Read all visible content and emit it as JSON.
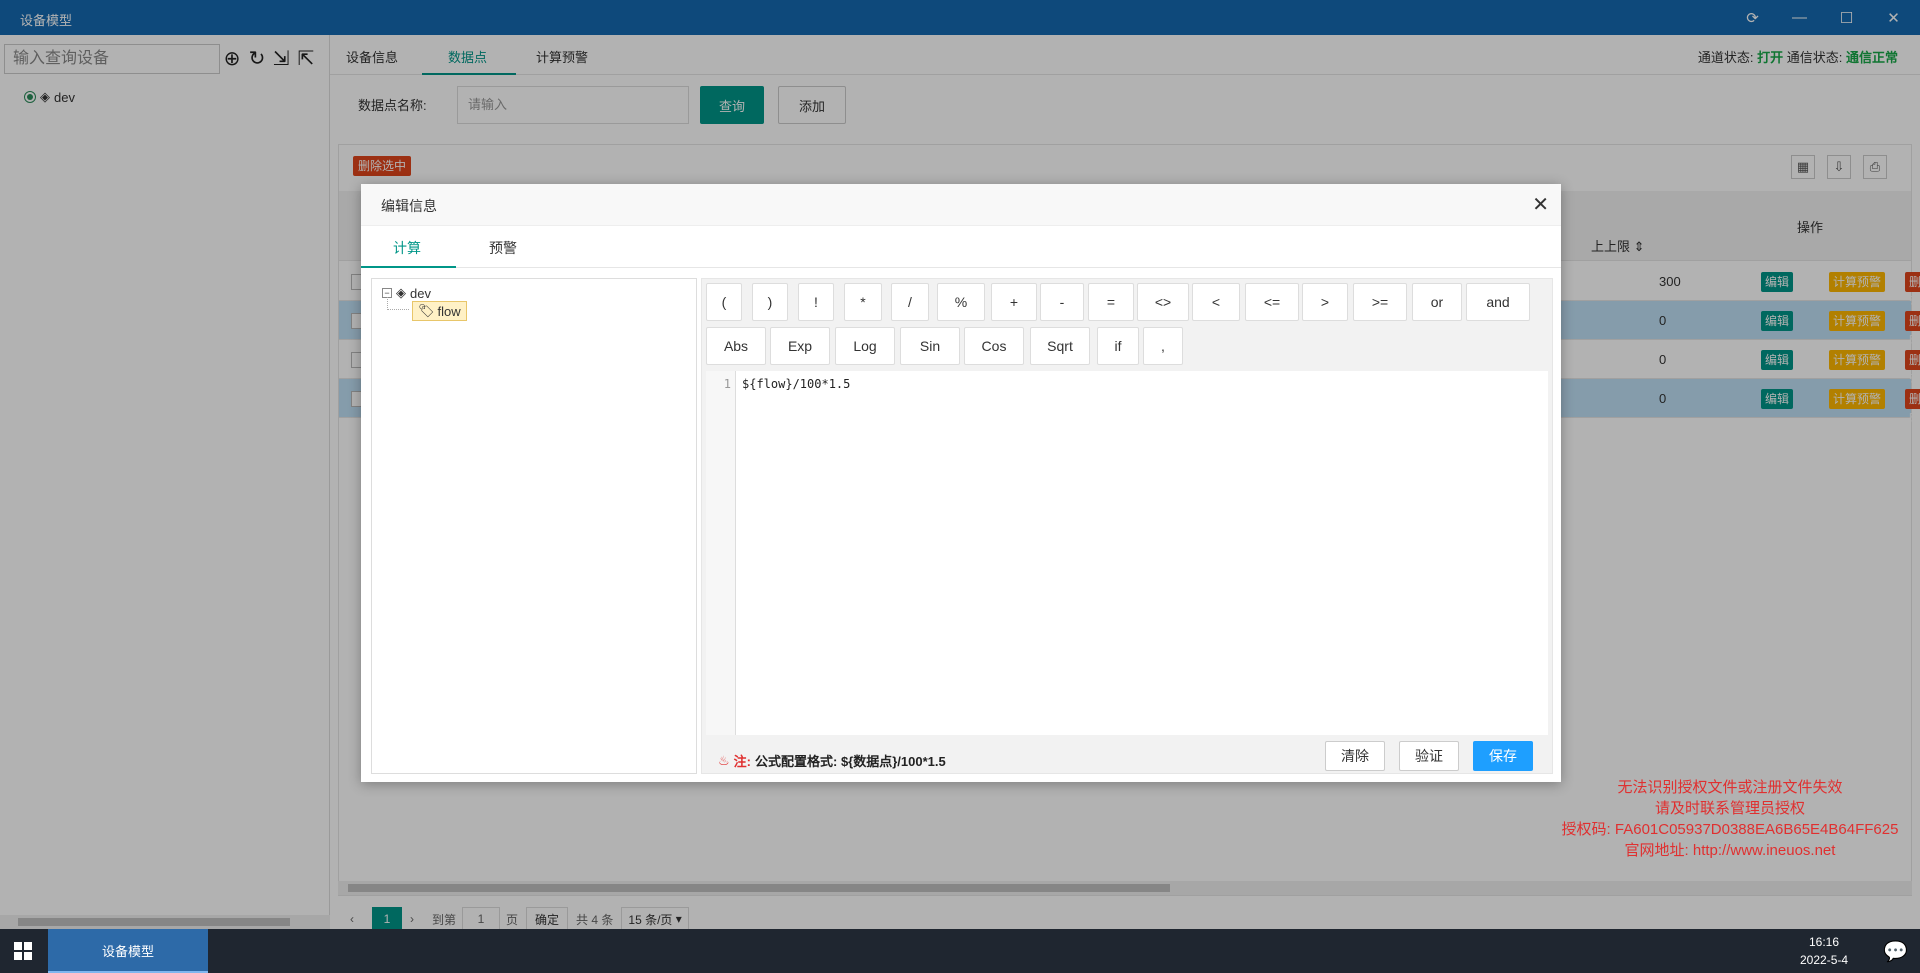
{
  "window": {
    "title": "设备模型",
    "controls": [
      "sync-icon",
      "minimize-icon",
      "maximize-icon",
      "close-icon"
    ]
  },
  "left": {
    "search_placeholder": "输入查询设备",
    "tree_root": "dev",
    "toolbar_icons": [
      "add-circle-icon",
      "refresh-icon",
      "import-icon",
      "export-icon"
    ]
  },
  "main": {
    "tabs": [
      "设备信息",
      "数据点",
      "计算预警"
    ],
    "active_tab": "数据点",
    "status": {
      "channel_label": "通道状态:",
      "channel_value": "打开",
      "comm_label": "通信状态:",
      "comm_value": "通信正常"
    },
    "filter": {
      "label": "数据点名称:",
      "placeholder": "请输入",
      "query": "查询",
      "add": "添加"
    },
    "delete_selected": "删除选中",
    "columns": {
      "upper_limit": "上上限",
      "operation": "操作"
    },
    "rows": [
      {
        "upper": "300",
        "selected": false
      },
      {
        "upper": "0",
        "selected": true
      },
      {
        "upper": "0",
        "selected": false
      },
      {
        "upper": "0",
        "selected": true
      }
    ],
    "row_actions": {
      "edit": "编辑",
      "warn": "计算预警",
      "delete": "删除"
    },
    "pager": {
      "current": "1",
      "goto": "到第",
      "page_input": "1",
      "page": "页",
      "confirm": "确定",
      "total": "共 4 条",
      "per_page": "15 条/页"
    }
  },
  "modal": {
    "title": "编辑信息",
    "tabs": [
      "计算",
      "预警"
    ],
    "active_tab": "计算",
    "tree": {
      "root": "dev",
      "child": "flow"
    },
    "operators_row1": [
      "(",
      ")",
      "!",
      "*",
      "/",
      "%",
      "+",
      "-",
      "=",
      "<>",
      "<",
      "<=",
      ">",
      ">=",
      "or",
      "and"
    ],
    "operators_row2": [
      "Abs",
      "Exp",
      "Log",
      "Sin",
      "Cos",
      "Sqrt",
      "if",
      ","
    ],
    "code_line_number": "1",
    "code": "${flow}/100*1.5",
    "note_prefix": "注:",
    "note_text": "公式配置格式: ${数据点}/100*1.5",
    "buttons": {
      "clear": "清除",
      "verify": "验证",
      "save": "保存"
    }
  },
  "watermark": [
    "无法识别授权文件或注册文件失效",
    "请及时联系管理员授权",
    "授权码: FA601C05937D0388EA6B65E4B64FF625",
    "官网地址: http://www.ineuos.net"
  ],
  "taskbar": {
    "task": "设备模型",
    "time": "16:16",
    "date": "2022-5-4"
  },
  "colors": {
    "titlebar": "#1569b0",
    "accent": "#009688",
    "danger": "#e0461c",
    "warn": "#ffb800",
    "primary": "#1e9fff"
  }
}
